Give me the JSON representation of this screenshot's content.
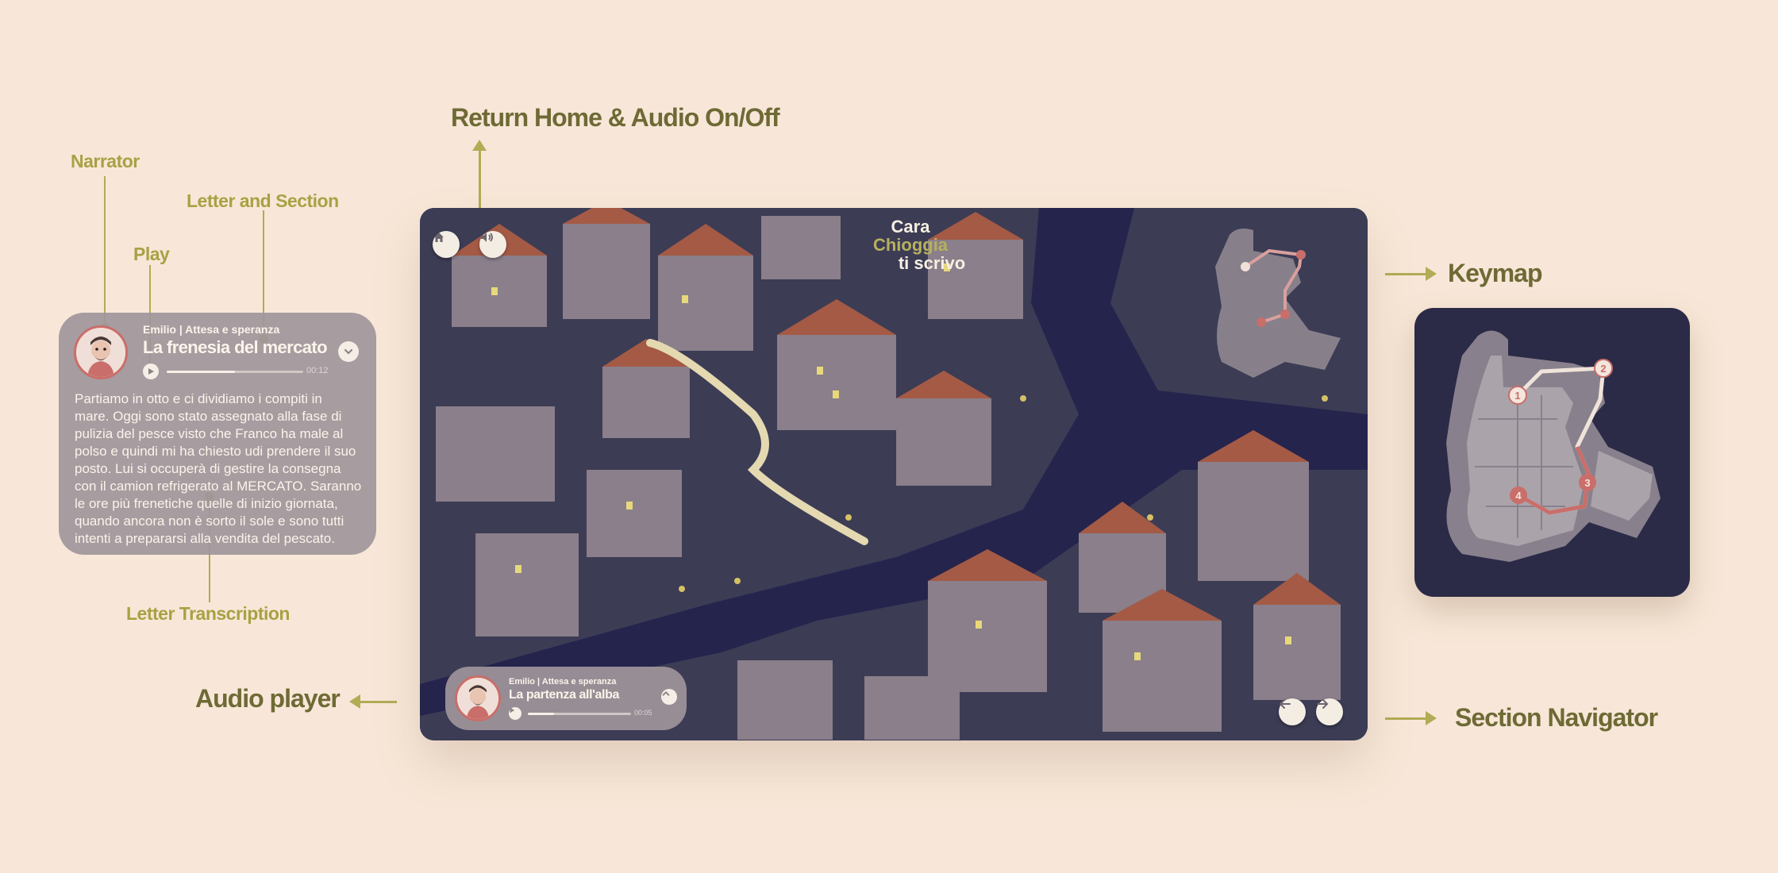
{
  "annotations": {
    "return_home_audio": "Return Home & Audio On/Off",
    "narrator": "Narrator",
    "letter_section": "Letter and Section",
    "play": "Play",
    "keymap": "Keymap",
    "letter_transcription": "Letter Transcription",
    "audio_player": "Audio player",
    "section_navigator": "Section Navigator"
  },
  "logo": {
    "line1": "Cara",
    "line2": "Chioggia",
    "line3": "ti scrivo"
  },
  "expanded_player": {
    "meta": "Emilio | Attesa e speranza",
    "title": "La frenesia del mercato",
    "time": "00:12",
    "progress": 0.5,
    "transcript": [
      "Partiamo in otto e ci dividiamo i compiti  in",
      "mare. Oggi sono stato assegnato alla  fase di",
      "pulizia del pesce visto che Franco ha male al",
      "polso e quindi mi ha chiesto udi prendere il suo",
      "posto. Lui si occuperà di  gestire la consegna",
      "con il camion refrigerato al MERCATO. Saranno",
      "le ore più frenetiche quelle di inizio giornata,",
      "quando ancora non è sorto il sole e sono tutti",
      "intenti a prepararsi alla vendita del pescato."
    ]
  },
  "mini_player": {
    "meta": "Emilio | Attesa e speranza",
    "title": "La partenza all'alba",
    "time": "00:05",
    "progress": 0.25
  },
  "keymap_points": [
    "1",
    "2",
    "3",
    "4"
  ],
  "icons": {
    "home": "home-icon",
    "audio": "speaker-icon",
    "play": "play-icon",
    "expand": "chevron-down-icon",
    "collapse": "chevron-up-icon",
    "prev": "arrow-left-icon",
    "next": "arrow-right-icon"
  },
  "colors": {
    "background": "#f8e7d8",
    "annotation": "#a9a144",
    "annotation_dark": "#6e6a35",
    "keymap_bg": "#2b2b47",
    "route": "#c96e6a"
  }
}
